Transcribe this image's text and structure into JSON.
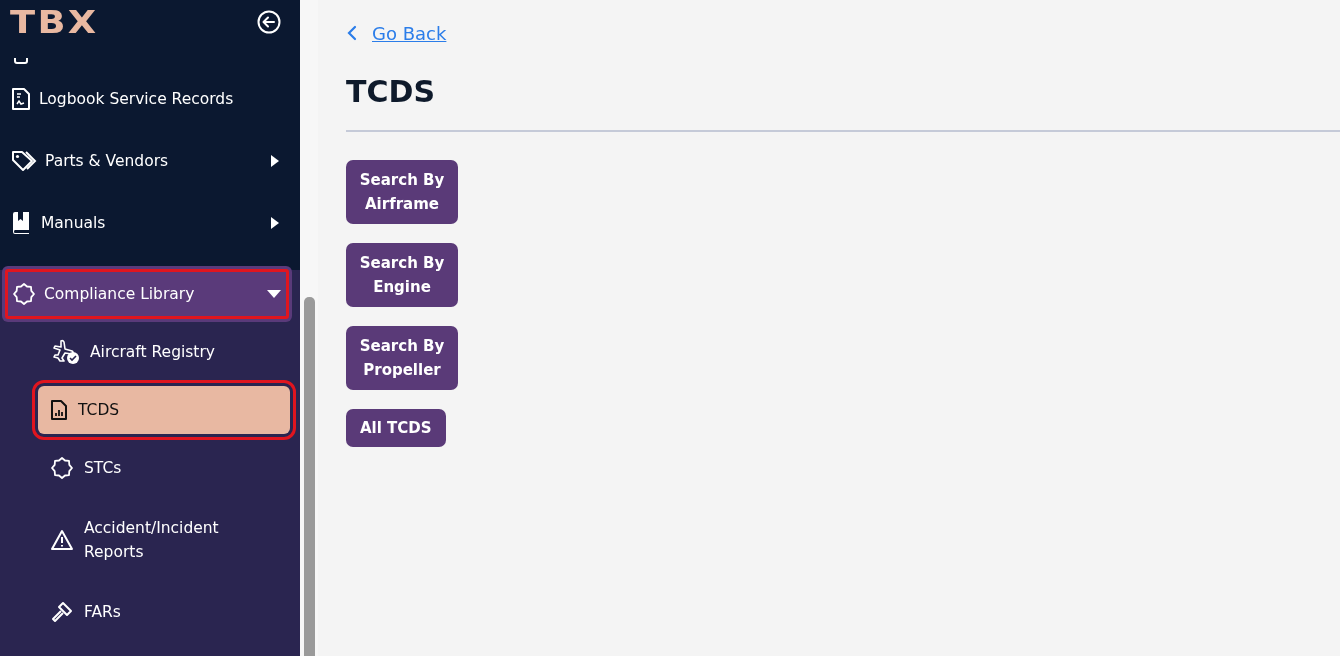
{
  "sidebar": {
    "logo": "TBX",
    "items": [
      {
        "label": "Logbook Service Records",
        "has_submenu": false,
        "expanded": false,
        "highlighted": false
      },
      {
        "label": "Parts & Vendors",
        "has_submenu": true,
        "expanded": false,
        "highlighted": false
      },
      {
        "label": "Manuals",
        "has_submenu": true,
        "expanded": false,
        "highlighted": false
      },
      {
        "label": "Compliance Library",
        "has_submenu": true,
        "expanded": true,
        "highlighted": true,
        "children": [
          {
            "label": "Aircraft Registry",
            "selected": false,
            "highlighted": false
          },
          {
            "label": "TCDS",
            "selected": true,
            "highlighted": true
          },
          {
            "label": "STCs",
            "selected": false,
            "highlighted": false
          },
          {
            "label": "Accident/Incident Reports",
            "selected": false,
            "highlighted": false
          },
          {
            "label": "FARs",
            "selected": false,
            "highlighted": false
          }
        ]
      }
    ]
  },
  "main": {
    "back_link": "Go Back",
    "title": "TCDS",
    "buttons": [
      {
        "label": "Search By Airframe"
      },
      {
        "label": "Search By Engine"
      },
      {
        "label": "Search By Propeller"
      },
      {
        "label": "All TCDS"
      }
    ]
  }
}
